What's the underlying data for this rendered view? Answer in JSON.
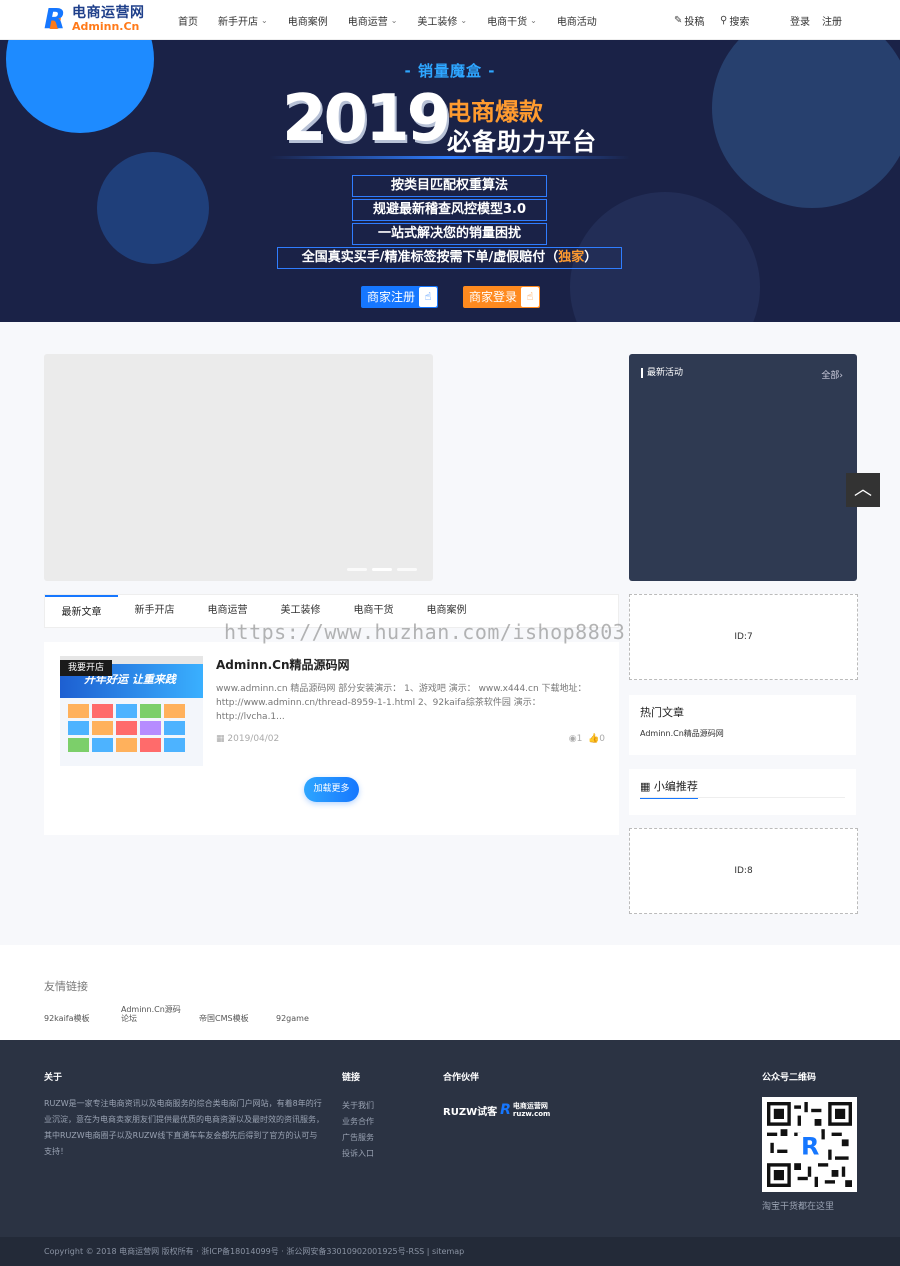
{
  "header": {
    "logo_cn": "电商运营网",
    "logo_en": "Adminn.Cn",
    "nav": [
      {
        "label": "首页",
        "caret": false
      },
      {
        "label": "新手开店",
        "caret": true
      },
      {
        "label": "电商案例",
        "caret": false
      },
      {
        "label": "电商运营",
        "caret": true
      },
      {
        "label": "美工装修",
        "caret": true
      },
      {
        "label": "电商干货",
        "caret": true
      },
      {
        "label": "电商活动",
        "caret": false
      }
    ],
    "submit": "投稿",
    "search": "搜索",
    "login": "登录",
    "register": "注册"
  },
  "banner": {
    "subtitle": "- 销量魔盒 -",
    "year": "2019",
    "line1": "电商爆款",
    "line2": "必备助力平台",
    "features": [
      "按类目匹配权重算法",
      "规避最新稽查风控模型3.0",
      "一站式解决您的销量困扰"
    ],
    "feature4_pre": "全国真实买手/精准标签按需下单/虚假赔付（",
    "feature4_hl": "独家",
    "feature4_post": "）",
    "btn_register": "商家注册",
    "btn_login": "商家登录"
  },
  "tabs": [
    "最新文章",
    "新手开店",
    "电商运营",
    "美工装修",
    "电商干货",
    "电商案例"
  ],
  "watermark": "https://www.huzhan.com/ishop8803",
  "article": {
    "badge": "我要开店",
    "thumb_text": "开年好运 让重来践",
    "title": "Adminn.Cn精品源码网",
    "excerpt": "www.adminn.cn 精品源码网 部分安装演示： 1、游戏吧 演示： www.x444.cn 下载地址：http://www.adminn.cn/thread-8959-1-1.html 2、92kaifa综茶软件园 演示：http://lvcha.1...",
    "date": "2019/04/02",
    "views": "1",
    "likes": "0"
  },
  "load_more": "加载更多",
  "sidebar": {
    "activity_title": "最新活动",
    "activity_all": "全部",
    "ad1": "ID:7",
    "hot_title": "热门文章",
    "hot_item": "Adminn.Cn精品源码网",
    "rec_title": "小编推荐",
    "ad2": "ID:8"
  },
  "friend_links": {
    "title": "友情链接",
    "items": [
      "92kaifa模板",
      "Adminn.Cn源码论坛",
      "帝国CMS模板",
      "92game"
    ]
  },
  "footer": {
    "about_title": "关于",
    "about_text": "RUZW是一家专注电商资讯以及电商服务的综合类电商门户网站，有着8年的行业沉淀，意在为电商卖家朋友们提供最优质的电商资源以及最时效的资讯服务，其中RUZW电商圈子以及RUZW线下直通车车友会都先后得到了官方的认可与支持！",
    "links_title": "链接",
    "links": [
      "关于我们",
      "业务合作",
      "广告服务",
      "投诉入口"
    ],
    "partner_title": "合作伙伴",
    "partner_text": "RUZW试客",
    "partner_logo": "电商运营网 ruzw.com",
    "qr_title": "公众号二维码",
    "qr_caption": "淘宝干货都在这里",
    "copyright": "Copyright © 2018 电商运营网 版权所有 · 浙ICP备18014099号 · 浙公网安备33010902001925号-RSS | sitemap"
  }
}
